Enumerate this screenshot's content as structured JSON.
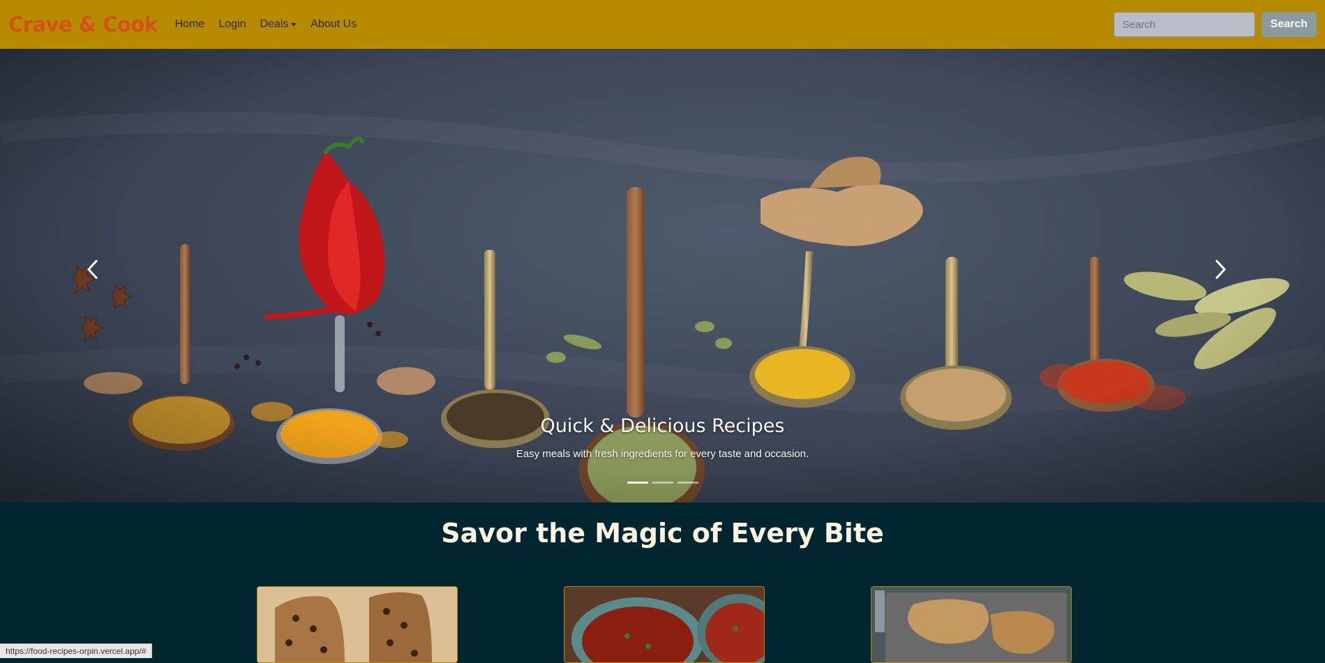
{
  "navbar": {
    "brand": "Crave & Cook",
    "links": [
      {
        "label": "Home"
      },
      {
        "label": "Login"
      },
      {
        "label": "Deals"
      },
      {
        "label": "About Us"
      }
    ],
    "search": {
      "placeholder": "Search",
      "value": "",
      "button_label": "Search"
    }
  },
  "hero": {
    "title": "Quick & Delicious Recipes",
    "subtitle": "Easy meals with fresh ingredients for every taste and occasion.",
    "slide_count": 3,
    "active_slide": 0
  },
  "section": {
    "title": "Savor the Magic of Every Bite"
  },
  "cards": [
    {
      "image": "chocolate-chip-bread"
    },
    {
      "image": "tomato-soup-bowls"
    },
    {
      "image": "breaded-pork-chops"
    }
  ],
  "status_bar": {
    "url": "https://food-recipes-orpin.vercel.app/#"
  },
  "colors": {
    "navbar_bg": "#b78a00",
    "brand": "#d4511c",
    "page_bg": "#02262f",
    "section_title": "#fdf3e3"
  }
}
